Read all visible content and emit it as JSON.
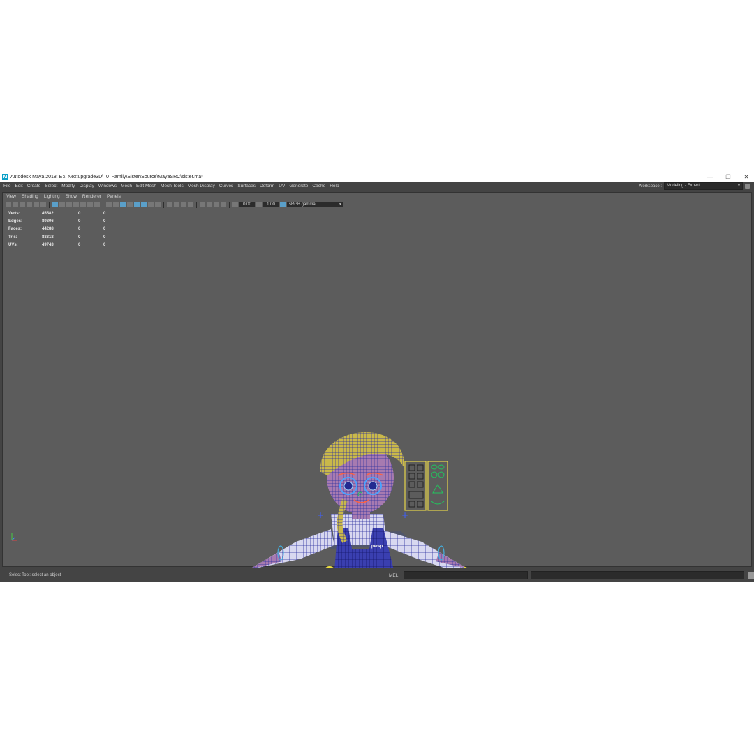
{
  "window": {
    "title": "Autodesk Maya 2018: E:\\_Nextupgrade3D\\_0_Family\\Sister\\Source\\MayaSRC\\sister.ma*",
    "controls": [
      "—",
      "❐",
      "✕"
    ]
  },
  "menubar": {
    "items": [
      "File",
      "Edit",
      "Create",
      "Select",
      "Modify",
      "Display",
      "Windows",
      "Mesh",
      "Edit Mesh",
      "Mesh Tools",
      "Mesh Display",
      "Curves",
      "Surfaces",
      "Deform",
      "UV",
      "Generate",
      "Cache",
      "Help"
    ],
    "workspace_label": "Workspace :",
    "workspace_value": "Modeling - Expert"
  },
  "panel": {
    "menus": [
      "View",
      "Shading",
      "Lighting",
      "Show",
      "Renderer",
      "Panels"
    ],
    "toolbar": {
      "exposure": "0.00",
      "gamma": "1.00",
      "color_space": "sRGB gamma"
    },
    "camera": "persp"
  },
  "hud": {
    "rows": [
      {
        "label": "Verts:",
        "v1": "45582",
        "v2": "0",
        "v3": "0"
      },
      {
        "label": "Edges:",
        "v1": "89806",
        "v2": "0",
        "v3": "0"
      },
      {
        "label": "Faces:",
        "v1": "44288",
        "v2": "0",
        "v3": "0"
      },
      {
        "label": "Tris:",
        "v1": "88318",
        "v2": "0",
        "v3": "0"
      },
      {
        "label": "UVs:",
        "v1": "49743",
        "v2": "0",
        "v3": "0"
      }
    ]
  },
  "statusbar": {
    "message": "Select Tool: select an object",
    "mel_label": "MEL"
  },
  "colors": {
    "viewport_bg": "#5c5c5c",
    "ui_bg": "#444444",
    "wire_blue": "#2a2f9e",
    "wire_yellow": "#d8c640",
    "control_green": "#22c55e"
  }
}
